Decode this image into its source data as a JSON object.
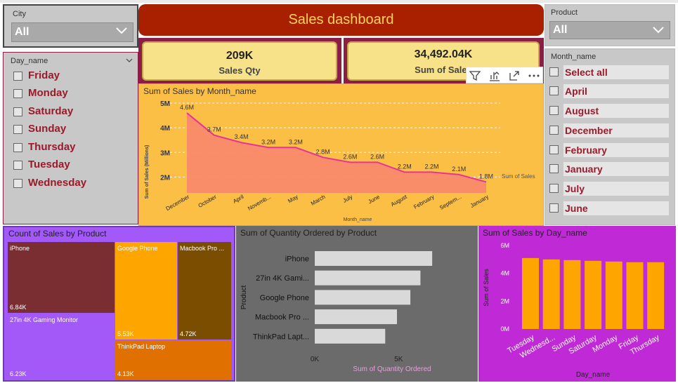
{
  "city_slicer": {
    "title": "City",
    "value": "All"
  },
  "product_slicer": {
    "title": "Product",
    "value": "All"
  },
  "day_slicer": {
    "title": "Day_name",
    "items": [
      "Friday",
      "Monday",
      "Saturday",
      "Sunday",
      "Thursday",
      "Tuesday",
      "Wednesday"
    ]
  },
  "month_slicer": {
    "title": "Month_name",
    "items": [
      "Select all",
      "April",
      "August",
      "December",
      "February",
      "January",
      "July",
      "June"
    ]
  },
  "header": {
    "title": "Sales dashboard"
  },
  "cards": {
    "qty": {
      "value": "209K",
      "label": "Sales Qty"
    },
    "sales": {
      "value": "34,492.04K",
      "label": "Sum of Sales"
    }
  },
  "line_chart": {
    "title": "Sum of Sales by Month_name",
    "ylabel": "Sum of Sales (Millions)",
    "xlabel": "Month_name",
    "series_label": "Sum of Sales",
    "yticks": [
      "5M",
      "4M",
      "3M",
      "2M"
    ],
    "point_labels": [
      "4.6M",
      "3.7M",
      "3.4M",
      "3.2M",
      "3.2M",
      "2.8M",
      "2.6M",
      "2.6M",
      "2.2M",
      "2.2M",
      "2.1M",
      "1.8M"
    ],
    "categories": [
      "December",
      "October",
      "April",
      "Novemb...",
      "May",
      "March",
      "July",
      "June",
      "August",
      "February",
      "Septem...",
      "January"
    ]
  },
  "treemap": {
    "title": "Count of Sales by Product",
    "cells": [
      {
        "name": "iPhone",
        "value": "6.84K",
        "color": "#7a2e31"
      },
      {
        "name": "27in 4K Gaming Monitor",
        "value": "6.23K",
        "color": "#a259f7"
      },
      {
        "name": "Google Phone",
        "value": "5.53K",
        "color": "#ffa500"
      },
      {
        "name": "Macbook Pro ...",
        "value": "4.72K",
        "color": "#7a4d00"
      },
      {
        "name": "ThinkPad Laptop",
        "value": "4.13K",
        "color": "#e07000"
      }
    ]
  },
  "bar_chart": {
    "title": "Sum of Quantity Ordered by Product",
    "ylabel": "Product",
    "xlabel": "Sum of Quantity Ordered",
    "xticks": [
      "0K",
      "5K"
    ],
    "categories": [
      "iPhone",
      "27in 4K Gami...",
      "Google Phone",
      "Macbook Pro ...",
      "ThinkPad Lapt..."
    ]
  },
  "column_chart": {
    "title": "Sum of Sales by Day_name",
    "ylabel": "Sum of Sales",
    "xlabel": "Day_name",
    "yticks": [
      "6M",
      "4M",
      "2M",
      "0M"
    ],
    "categories": [
      "Tuesday",
      "Wednesd...",
      "Sunday",
      "Saturday",
      "Monday",
      "Friday",
      "Thursday"
    ]
  },
  "toolbar": {
    "icons": [
      "filter-icon",
      "focus-mode-icon",
      "expand-icon",
      "more-options-icon"
    ]
  },
  "colors": {
    "header_bg": "#a82000",
    "header_text": "#ffd35a",
    "card_bg": "#f7e28a",
    "line_panel_bg": "#fcbf45",
    "line_color": "#e6339a",
    "area_fill": "#f98a6c",
    "bar_color": "#d9d9d9",
    "column_color": "#ffa500",
    "slicer_text": "#9b1a2a"
  },
  "chart_data": [
    {
      "type": "area",
      "title": "Sum of Sales by Month_name",
      "xlabel": "Month_name",
      "ylabel": "Sum of Sales (Millions)",
      "categories": [
        "December",
        "October",
        "April",
        "Novemb...",
        "May",
        "March",
        "July",
        "June",
        "August",
        "February",
        "Septem...",
        "January"
      ],
      "series": [
        {
          "name": "Sum of Sales",
          "values": [
            4.6,
            3.7,
            3.4,
            3.2,
            3.2,
            2.8,
            2.6,
            2.6,
            2.2,
            2.2,
            2.1,
            1.8
          ]
        }
      ],
      "ylim": [
        1.5,
        5.0
      ],
      "grid": true,
      "legend": "right"
    },
    {
      "type": "bar",
      "title": "Sum of Quantity Ordered by Product",
      "xlabel": "Sum of Quantity Ordered",
      "ylabel": "Product",
      "categories": [
        "iPhone",
        "27in 4K Gami...",
        "Google Phone",
        "Macbook Pro ...",
        "ThinkPad Lapt..."
      ],
      "values": [
        7.0,
        6.3,
        5.7,
        4.9,
        4.2
      ],
      "xlim": [
        0,
        8
      ]
    },
    {
      "type": "bar",
      "title": "Sum of Sales by Day_name",
      "xlabel": "Day_name",
      "ylabel": "Sum of Sales",
      "categories": [
        "Tuesday",
        "Wednesd...",
        "Sunday",
        "Saturday",
        "Monday",
        "Friday",
        "Thursday"
      ],
      "values": [
        5.1,
        5.0,
        4.95,
        4.9,
        4.85,
        4.8,
        4.8
      ],
      "ylim": [
        0,
        6
      ]
    }
  ]
}
